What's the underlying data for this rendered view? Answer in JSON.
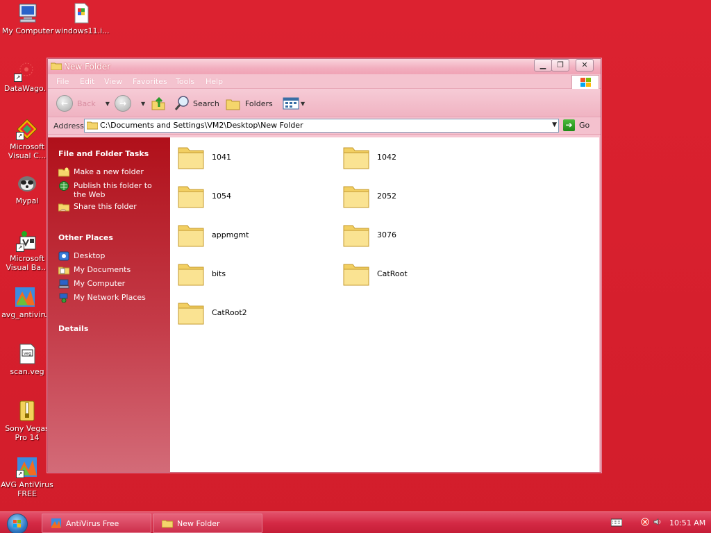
{
  "desktop": {
    "icons": [
      {
        "label": "My Computer",
        "icon": "my-computer-icon"
      },
      {
        "label": "windows11.i...",
        "icon": "iso-file-icon"
      },
      {
        "label": "DataWago.",
        "icon": "datawago-icon"
      },
      {
        "label": "Microsoft\nVisual C...",
        "icon": "visual-c-icon"
      },
      {
        "label": "Mypal",
        "icon": "mypal-icon"
      },
      {
        "label": "Microsoft\nVisual Ba...",
        "icon": "visual-basic-icon"
      },
      {
        "label": "avg_antiviru",
        "icon": "avg-installer-icon"
      },
      {
        "label": "scan.veg",
        "icon": "veg-file-icon"
      },
      {
        "label": "Sony Vegas\nPro 14",
        "icon": "sony-vegas-icon"
      },
      {
        "label": "AVG AntiVirus\nFREE",
        "icon": "avg-icon"
      }
    ]
  },
  "window": {
    "title": "New Folder",
    "menu": [
      "File",
      "Edit",
      "View",
      "Favorites",
      "Tools",
      "Help"
    ],
    "toolbar": {
      "back_label": "Back",
      "search_label": "Search",
      "folders_label": "Folders"
    },
    "address": {
      "label": "Address",
      "path": "C:\\Documents and Settings\\VM2\\Desktop\\New Folder",
      "go_label": "Go"
    },
    "taskpane": {
      "file_tasks_title": "File and Folder Tasks",
      "file_tasks": [
        {
          "label": "Make a new folder",
          "icon": "new-folder-icon"
        },
        {
          "label": "Publish this folder to the Web",
          "icon": "publish-web-icon"
        },
        {
          "label": "Share this folder",
          "icon": "share-folder-icon"
        }
      ],
      "other_places_title": "Other Places",
      "other_places": [
        {
          "label": "Desktop",
          "icon": "desktop-icon"
        },
        {
          "label": "My Documents",
          "icon": "my-documents-icon"
        },
        {
          "label": "My Computer",
          "icon": "my-computer-icon"
        },
        {
          "label": "My Network Places",
          "icon": "network-places-icon"
        }
      ],
      "details_title": "Details"
    },
    "folders": [
      "1041",
      "1042",
      "1054",
      "2052",
      "appmgmt",
      "3076",
      "bits",
      "CatRoot",
      "CatRoot2"
    ]
  },
  "taskbar": {
    "tasks": [
      {
        "label": "AntiVirus Free",
        "icon": "avg-icon"
      },
      {
        "label": "New Folder",
        "icon": "folder-icon"
      }
    ],
    "clock": "10:51 AM"
  },
  "colors": {
    "desktop": "#d8202e",
    "taskpane": "#b0101a",
    "window_frame": "#f6c6d2"
  }
}
